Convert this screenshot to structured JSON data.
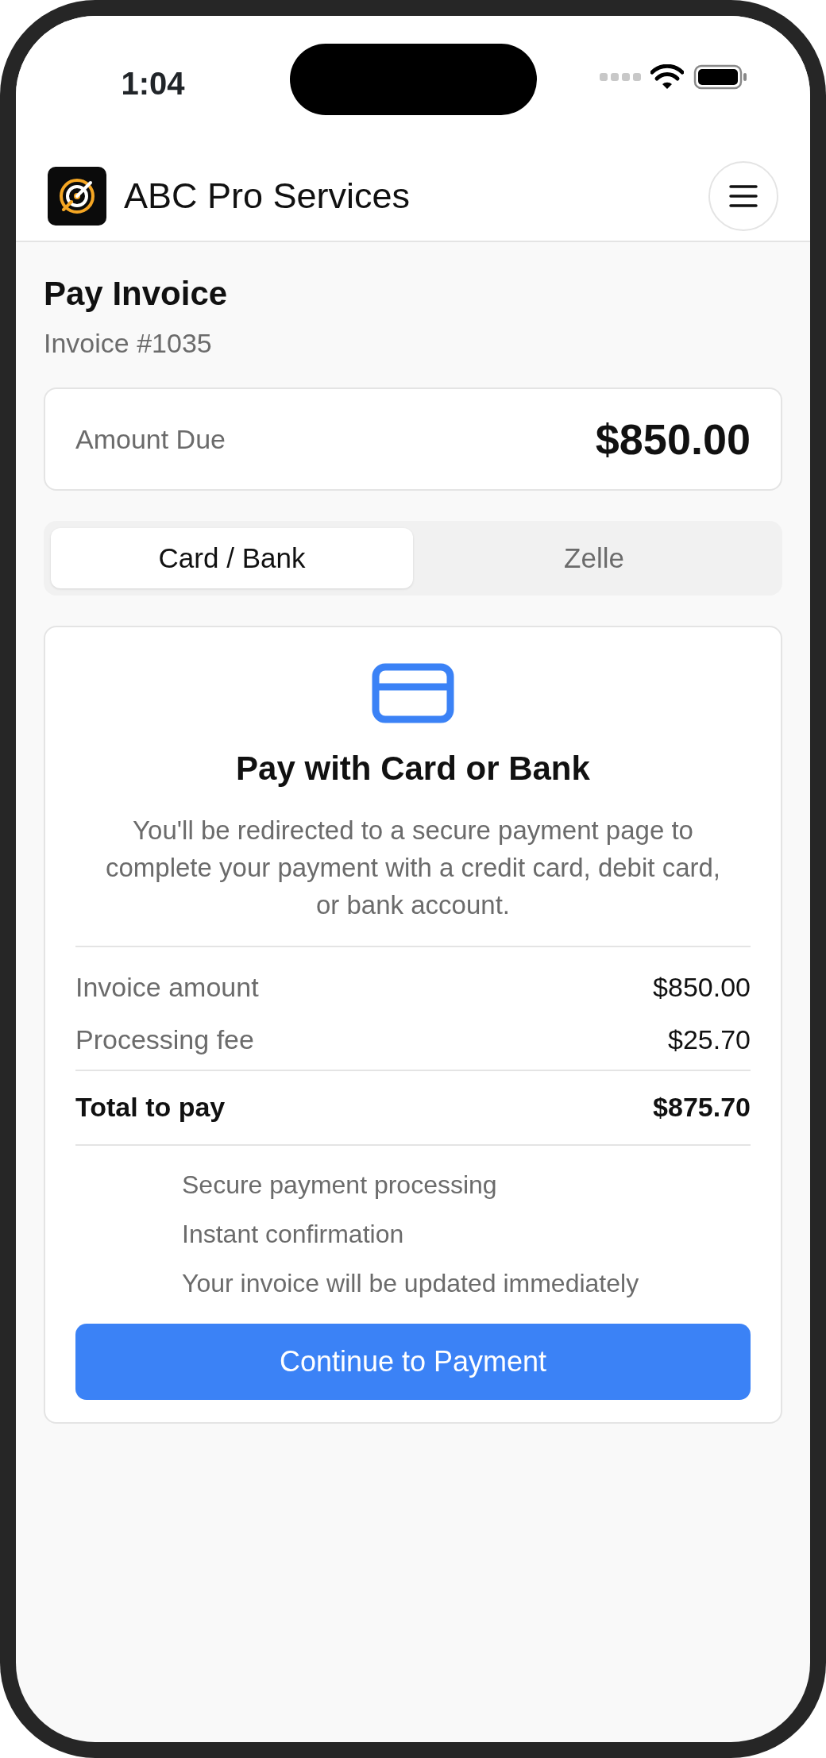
{
  "status_bar": {
    "time": "1:04"
  },
  "header": {
    "brand": "ABC Pro Services"
  },
  "page": {
    "title": "Pay Invoice",
    "subtitle": "Invoice #1035"
  },
  "amount": {
    "label": "Amount Due",
    "value": "$850.00"
  },
  "tabs": [
    {
      "label": "Card / Bank",
      "selected": true
    },
    {
      "label": "Zelle",
      "selected": false
    }
  ],
  "payment": {
    "heading": "Pay with Card or Bank",
    "description": "You'll be redirected to a secure payment page to complete your payment with a credit card, debit card, or bank account.",
    "rows": [
      {
        "kind": "line",
        "label": "Invoice amount",
        "value": "$850.00"
      },
      {
        "kind": "line",
        "label": "Processing fee",
        "value": "$25.70"
      },
      {
        "kind": "total",
        "label": "Total to pay",
        "value": "$875.70"
      }
    ],
    "features": [
      "Secure payment processing",
      "Instant confirmation",
      "Your invoice will be updated immediately"
    ],
    "button": "Continue to Payment"
  }
}
